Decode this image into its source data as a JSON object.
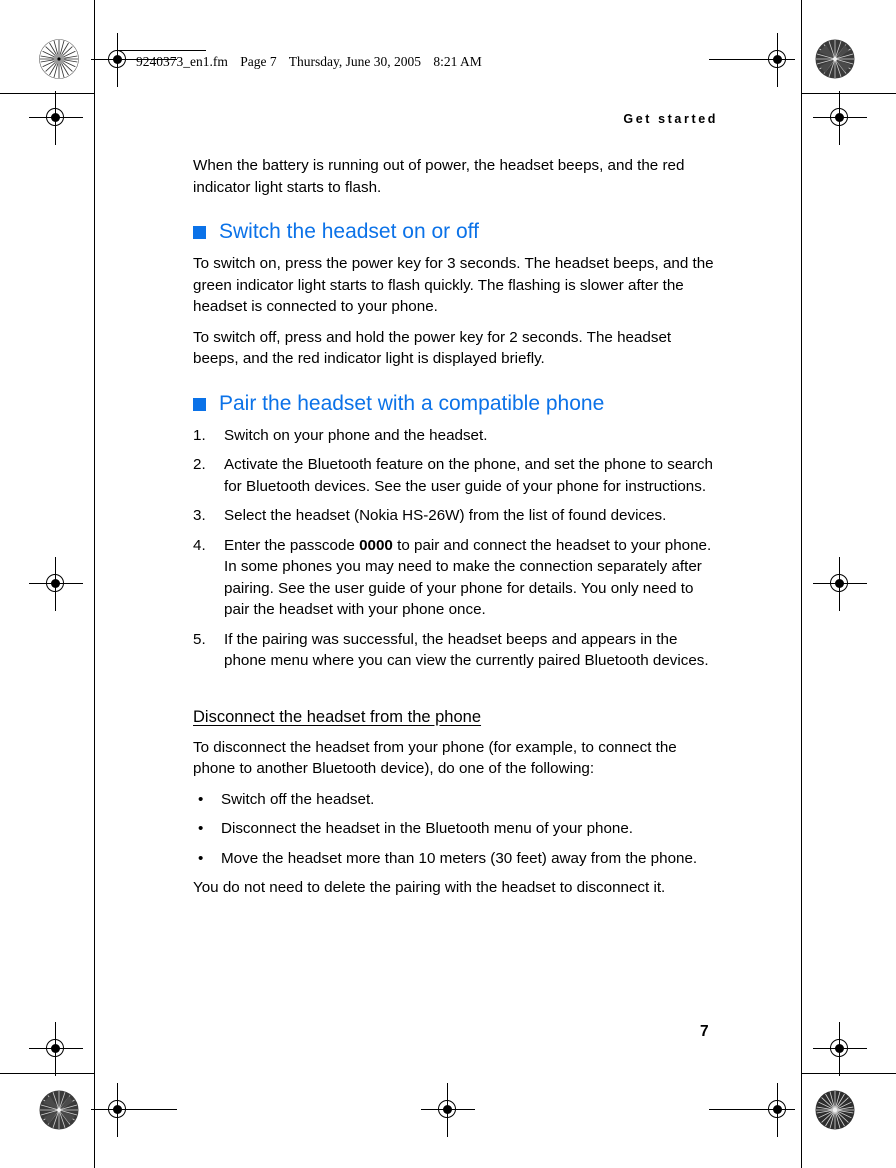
{
  "printmarks": {
    "filename_line": [
      "9240373_en1.fm",
      "Page 7",
      "Thursday, June 30, 2005",
      "8:21 AM"
    ]
  },
  "running_head": "Get started",
  "page_number": "7",
  "colors": {
    "heading_blue": "#0B72E8",
    "text_black": "#000000",
    "page_background": "#FFFFFF"
  },
  "content": {
    "intro_paragraph": "When the battery is running out of power, the headset beeps, and the red indicator light starts to flash.",
    "section_switch": {
      "heading": "Switch the headset on or off",
      "paragraphs": [
        "To switch on, press the power key for 3 seconds. The headset beeps, and the green indicator light starts to flash quickly. The flashing is slower after the headset is connected to your phone.",
        "To switch off, press and hold the power key for 2 seconds. The headset beeps, and the red indicator light is displayed briefly."
      ]
    },
    "section_pair": {
      "heading": "Pair the headset with a compatible phone",
      "steps": [
        {
          "number": "1.",
          "text": "Switch on your phone and the headset."
        },
        {
          "number": "2.",
          "text": "Activate the Bluetooth feature on the phone, and set the phone to search for Bluetooth devices. See the user guide of your phone for instructions."
        },
        {
          "number": "3.",
          "text": "Select the headset (Nokia HS-26W) from the list of found devices."
        },
        {
          "number": "4.",
          "text_before": "Enter the passcode ",
          "bold": "0000",
          "text_after": " to pair and connect the headset to your phone. In some phones you may need to make the connection separately after pairing. See the user guide of your phone for details. You only need to pair the headset with your phone once."
        },
        {
          "number": "5.",
          "text": "If the pairing was successful, the headset beeps and appears in the phone menu where you can view the currently paired Bluetooth devices."
        }
      ]
    },
    "section_disconnect": {
      "heading": "Disconnect the headset from the phone",
      "intro": "To disconnect the headset from your phone (for example, to connect the phone to another Bluetooth device), do one of the following:",
      "bullet_marker": "•",
      "bullets": [
        "Switch off the headset.",
        "Disconnect the headset in the Bluetooth menu of your phone.",
        "Move the headset more than 10 meters (30 feet) away from the phone."
      ],
      "closing": "You do not need to delete the pairing with the headset to disconnect it."
    }
  }
}
